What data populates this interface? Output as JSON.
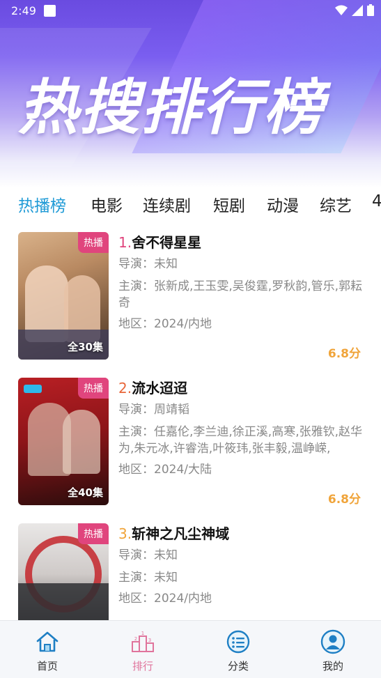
{
  "status_bar": {
    "time": "2:49"
  },
  "hero": {
    "title": "热搜排行榜"
  },
  "tabs": [
    {
      "label": "热播榜",
      "active": true
    },
    {
      "label": "电影"
    },
    {
      "label": "连续剧"
    },
    {
      "label": "短剧"
    },
    {
      "label": "动漫"
    },
    {
      "label": "综艺"
    },
    {
      "label": "4"
    }
  ],
  "items": [
    {
      "badge": "热播",
      "episodes": "全30集",
      "rank": "1.",
      "rank_color": "#e0457d",
      "title": "舍不得星星",
      "director": "导演：未知",
      "cast": "主演：张新成,王玉雯,吴俊霆,罗秋韵,管乐,郭耘奇",
      "region": "地区：2024/内地",
      "score": "6.8分"
    },
    {
      "badge": "热播",
      "episodes": "全40集",
      "rank": "2.",
      "rank_color": "#e8663a",
      "title": "流水迢迢",
      "director": "导演：周靖韬",
      "cast": "主演：任嘉伦,李兰迪,徐正溪,高寒,张雅钦,赵华为,朱元冰,许睿浩,叶筱玮,张丰毅,温峥嵘,",
      "region": "地区：2024/大陆",
      "score": "6.8分"
    },
    {
      "badge": "热播",
      "episodes": "",
      "rank": "3.",
      "rank_color": "#f0a43a",
      "title": "斩神之凡尘神域",
      "director": "导演：未知",
      "cast": "主演：未知",
      "region": "地区：2024/内地",
      "score": ""
    }
  ],
  "bottom_nav": [
    {
      "label": "首页",
      "icon": "home-icon"
    },
    {
      "label": "排行",
      "icon": "ranking-icon",
      "active": true
    },
    {
      "label": "分类",
      "icon": "category-icon"
    },
    {
      "label": "我的",
      "icon": "profile-icon"
    }
  ],
  "colors": {
    "accent": "#1e9ad6",
    "badge": "#e0457d",
    "score": "#f0a43a",
    "nav_active": "#e0749c"
  }
}
